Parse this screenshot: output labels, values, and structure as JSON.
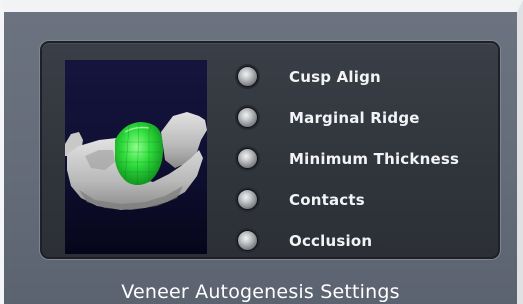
{
  "panel": {
    "preview_icon": "tooth-veneer-3d-preview",
    "options": [
      {
        "label": "Cusp Align"
      },
      {
        "label": "Marginal Ridge"
      },
      {
        "label": "Minimum Thickness"
      },
      {
        "label": "Contacts"
      },
      {
        "label": "Occlusion"
      }
    ]
  },
  "footer": {
    "title": "Veneer Autogenesis Settings"
  },
  "colors": {
    "background": "#656c79",
    "panel": "#33373e",
    "preview_bg": "#101034",
    "veneer": "#22d63a",
    "text": "#f2f3f5"
  }
}
